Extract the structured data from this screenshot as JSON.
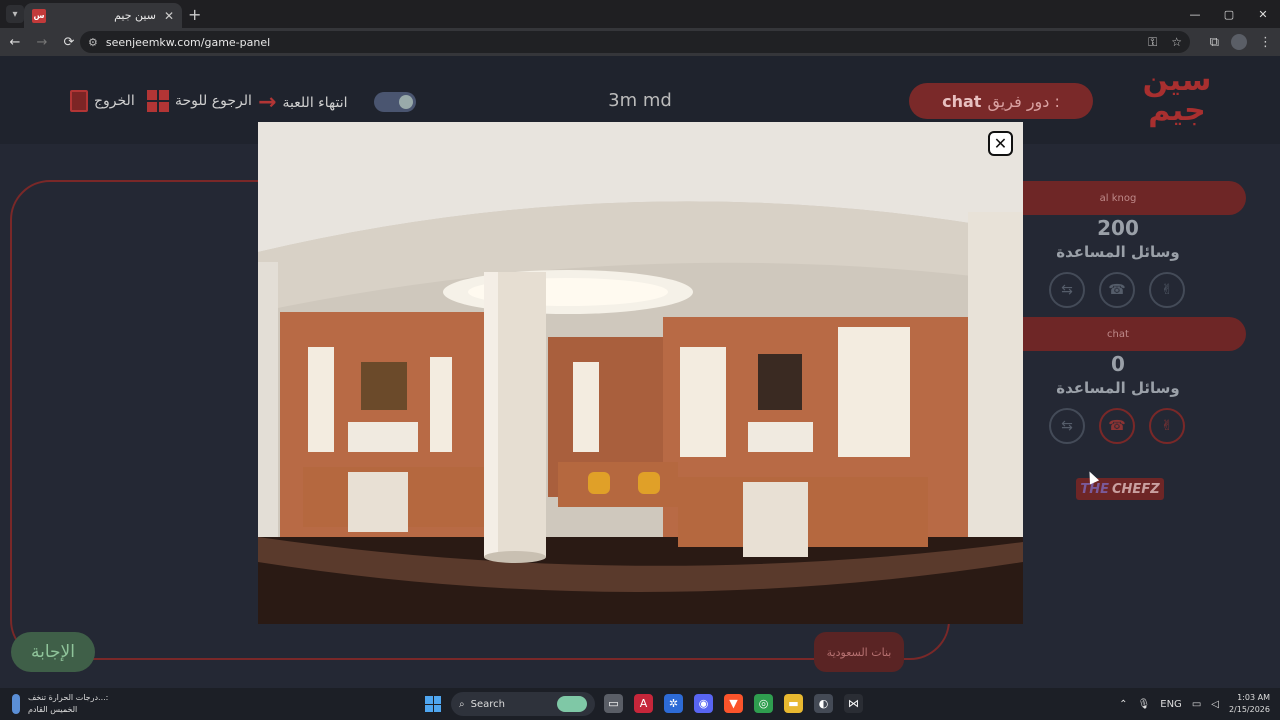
{
  "browser": {
    "tab_title": "سين جيم",
    "tab_close": "✕",
    "new_tab": "+",
    "url": "seenjeemkw.com/game-panel",
    "window_controls": [
      "—",
      "▢",
      "✕"
    ],
    "nav": {
      "back": "←",
      "forward": "→",
      "reload": "⟳"
    }
  },
  "header": {
    "exit_label": "الخروج",
    "back_to_board_label": "الرجوع للوحة",
    "end_game_label": "انتهاء اللعبة",
    "game_title": "3m md",
    "turn_label": "دور فريق :",
    "turn_team": "chat",
    "logo_text": "سين جيم"
  },
  "teams": [
    {
      "name": "al knog",
      "score": "200",
      "tools_label": "وسائل المساعدة"
    },
    {
      "name": "chat",
      "score": "0",
      "tools_label": "وسائل المساعدة"
    }
  ],
  "sponsor": {
    "the": "THE",
    "name": "CHEFZ"
  },
  "board": {
    "answer_button": "الإجابة",
    "category_button": "بنات السعودية"
  },
  "modal": {
    "close_label": "✕"
  },
  "taskbar": {
    "weather_line1": "درجات الحرارة تنخف...:",
    "weather_line2": "الخميس القادم",
    "search_label": "Search",
    "language": "ENG",
    "time": "1:03 AM",
    "date": "2/15/2026"
  },
  "colors": {
    "accent_red": "#b23535",
    "page_bg": "#242834",
    "answer_green": "#3f5f48"
  }
}
